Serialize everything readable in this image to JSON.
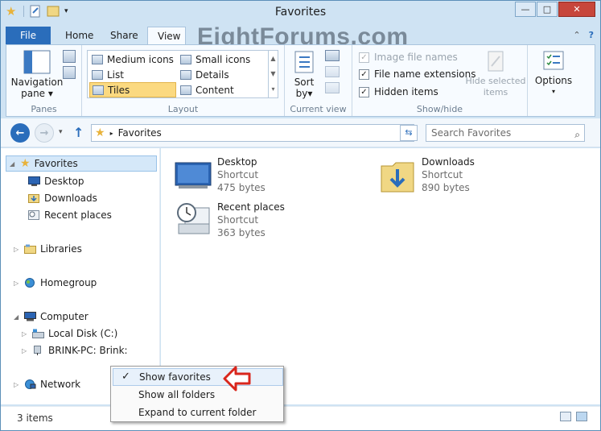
{
  "window": {
    "title": "Favorites"
  },
  "watermark": "EightForums.com",
  "tabs": [
    {
      "label": "File"
    },
    {
      "label": "Home"
    },
    {
      "label": "Share"
    },
    {
      "label": "View"
    }
  ],
  "ribbon": {
    "panes": {
      "nav_pane_line1": "Navigation",
      "nav_pane_line2": "pane",
      "group_label": "Panes"
    },
    "layout": {
      "items": [
        "Medium icons",
        "Small icons",
        "List",
        "Details",
        "Tiles",
        "Content"
      ],
      "selected": "Tiles",
      "group_label": "Layout"
    },
    "current_view": {
      "sort_line1": "Sort",
      "sort_line2": "by",
      "group_label": "Current view"
    },
    "show_hide": {
      "image_file_names": "Image file names",
      "file_name_extensions": "File name extensions",
      "hidden_items": "Hidden items",
      "hide_selected_line1": "Hide selected",
      "hide_selected_line2": "items",
      "group_label": "Show/hide"
    },
    "options": {
      "label": "Options"
    }
  },
  "address": {
    "location": "Favorites",
    "search_placeholder": "Search Favorites"
  },
  "nav_pane": {
    "favorites": "Favorites",
    "desktop": "Desktop",
    "downloads": "Downloads",
    "recent_places": "Recent places",
    "libraries": "Libraries",
    "homegroup": "Homegroup",
    "computer": "Computer",
    "local_disk": "Local Disk (C:)",
    "brink_pc": "BRINK-PC: Brink:",
    "network": "Network"
  },
  "files": [
    {
      "name": "Desktop",
      "type": "Shortcut",
      "size": "475 bytes"
    },
    {
      "name": "Downloads",
      "type": "Shortcut",
      "size": "890 bytes"
    },
    {
      "name": "Recent places",
      "type": "Shortcut",
      "size": "363 bytes"
    }
  ],
  "status": {
    "items": "3 items"
  },
  "context_menu": {
    "items": [
      "Show favorites",
      "Show all folders",
      "Expand to current folder"
    ],
    "checked": "Show favorites"
  },
  "colors": {
    "accent": "#2a6dbb",
    "selection": "#d5e8f9",
    "tiles_highlight": "#fbd980",
    "arrow": "#d9261c"
  }
}
